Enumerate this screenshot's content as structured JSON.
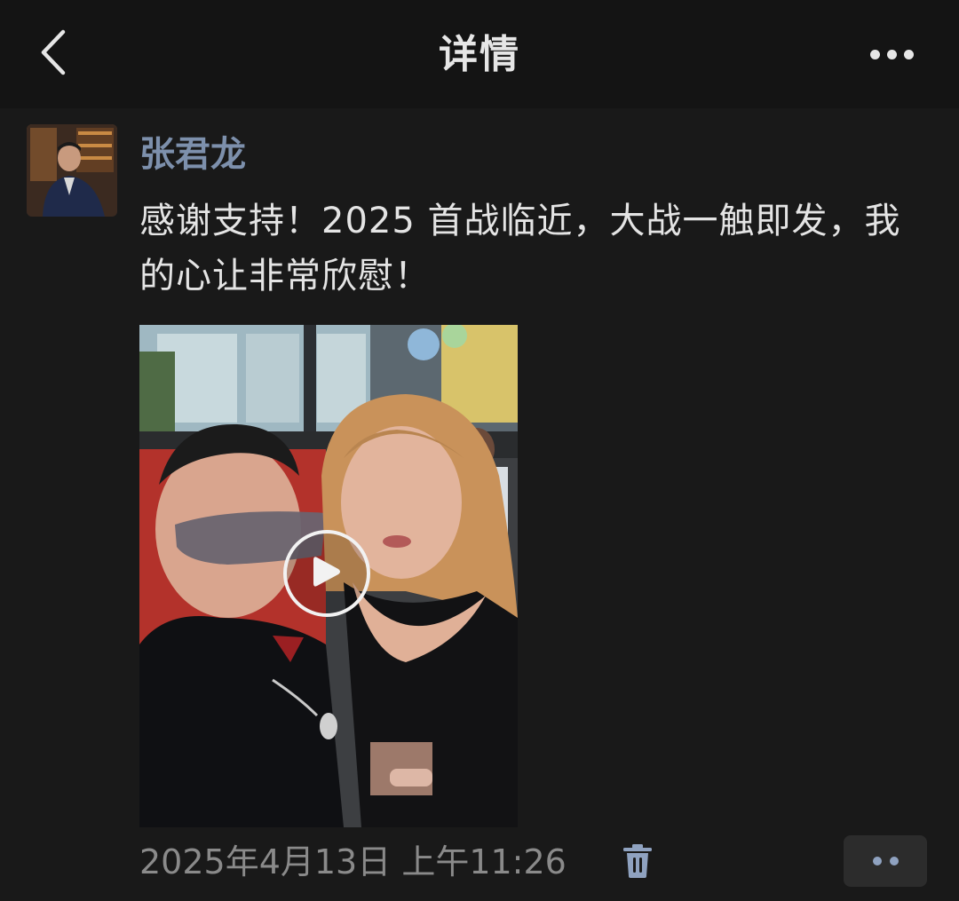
{
  "nav": {
    "title": "详情"
  },
  "post": {
    "author": "张君龙",
    "text": "感谢支持！2025 首战临近，大战一触即发，我的心让非常欣慰！",
    "timestamp": "2025年4月13日 上午11:26"
  },
  "icons": {
    "back": "chevron-left-icon",
    "more": "more-dots-icon",
    "play": "play-icon",
    "delete": "trash-icon",
    "actions": "two-dots-icon"
  },
  "colors": {
    "background": "#191919",
    "navbar": "#141414",
    "author_name": "#7d90ac",
    "body_text": "#e4e4e4",
    "timestamp": "#8a8a8a",
    "accent_icon": "#8fa2c0"
  }
}
